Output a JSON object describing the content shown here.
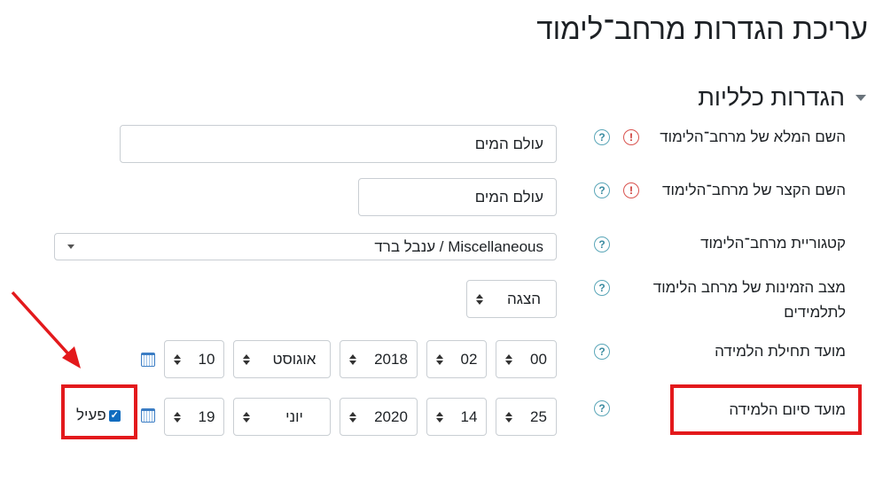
{
  "page_title": "עריכת הגדרות מרחב־לימוד",
  "section": {
    "title": "הגדרות כלליות",
    "expanded": true
  },
  "fields": {
    "fullname": {
      "label": "השם המלא של מרחב־הלימוד",
      "value": "עולם המים",
      "required": true
    },
    "shortname": {
      "label": "השם הקצר של מרחב־הלימוד",
      "value": "עולם המים",
      "required": true
    },
    "category": {
      "label": "קטגוריית מרחב־הלימוד",
      "value": "Miscellaneous / ענבל ברד"
    },
    "visibility": {
      "label_line1": "מצב הזמינות של מרחב הלימוד",
      "label_line2": "לתלמידים",
      "value": "הצגה"
    },
    "startdate": {
      "label": "מועד תחילת הלמידה",
      "day": "00",
      "month_num": "02",
      "year": "2018",
      "month": "אוגוסט",
      "hour": "10"
    },
    "enddate": {
      "label": "מועד סיום הלמידה",
      "day": "25",
      "month_num": "14",
      "year": "2020",
      "month": "יוני",
      "hour": "19",
      "enabled_label": "פעיל",
      "enabled": true
    }
  },
  "icons": {
    "help": "?",
    "required": "!",
    "check": "✓"
  },
  "colors": {
    "annotation_red": "#e3191c",
    "help_teal": "#3b8ba0",
    "required_red": "#c9302c",
    "checkbox_blue": "#0f6cbf"
  }
}
